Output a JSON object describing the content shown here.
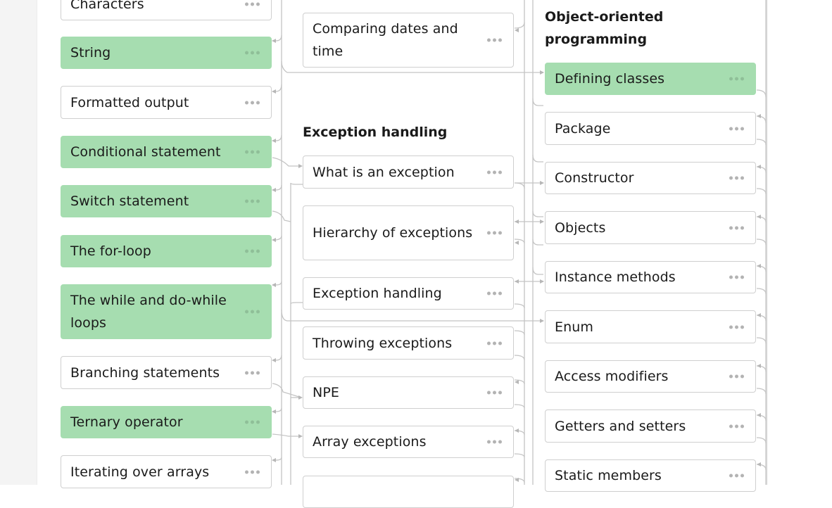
{
  "colors": {
    "completed": "#a6ddb0",
    "card_border": "#cfcfcf",
    "connector": "#c4c4c4"
  },
  "icons": {
    "more": "more-dots-icon",
    "arrow": "arrow-right-icon"
  },
  "columns": {
    "basics": {
      "items": [
        {
          "label": "Characters",
          "completed": false
        },
        {
          "label": "String",
          "completed": true
        },
        {
          "label": "Formatted output",
          "completed": false
        },
        {
          "label": "Conditional statement",
          "completed": true
        },
        {
          "label": "Switch statement",
          "completed": true
        },
        {
          "label": "The for-loop",
          "completed": true
        },
        {
          "label": "The while and do-while loops",
          "completed": true
        },
        {
          "label": "Branching statements",
          "completed": false
        },
        {
          "label": "Ternary operator",
          "completed": true
        },
        {
          "label": "Iterating over arrays",
          "completed": false
        }
      ]
    },
    "middle": {
      "top_items": [
        {
          "label": "Comparing dates and time",
          "completed": false
        }
      ],
      "exception_title": "Exception handling",
      "exception_items": [
        {
          "label": "What is an exception",
          "completed": false
        },
        {
          "label": "Hierarchy of exceptions",
          "completed": false
        },
        {
          "label": "Exception handling",
          "completed": false
        },
        {
          "label": "Throwing exceptions",
          "completed": false
        },
        {
          "label": "NPE",
          "completed": false
        },
        {
          "label": "Array exceptions",
          "completed": false
        },
        {
          "label": "",
          "completed": false
        }
      ]
    },
    "oop": {
      "title": "Object-oriented programming",
      "items": [
        {
          "label": "Defining classes",
          "completed": true
        },
        {
          "label": "Package",
          "completed": false
        },
        {
          "label": "Constructor",
          "completed": false
        },
        {
          "label": "Objects",
          "completed": false
        },
        {
          "label": "Instance methods",
          "completed": false
        },
        {
          "label": "Enum",
          "completed": false
        },
        {
          "label": "Access modifiers",
          "completed": false
        },
        {
          "label": "Getters and setters",
          "completed": false
        },
        {
          "label": "Static members",
          "completed": false
        }
      ]
    }
  }
}
